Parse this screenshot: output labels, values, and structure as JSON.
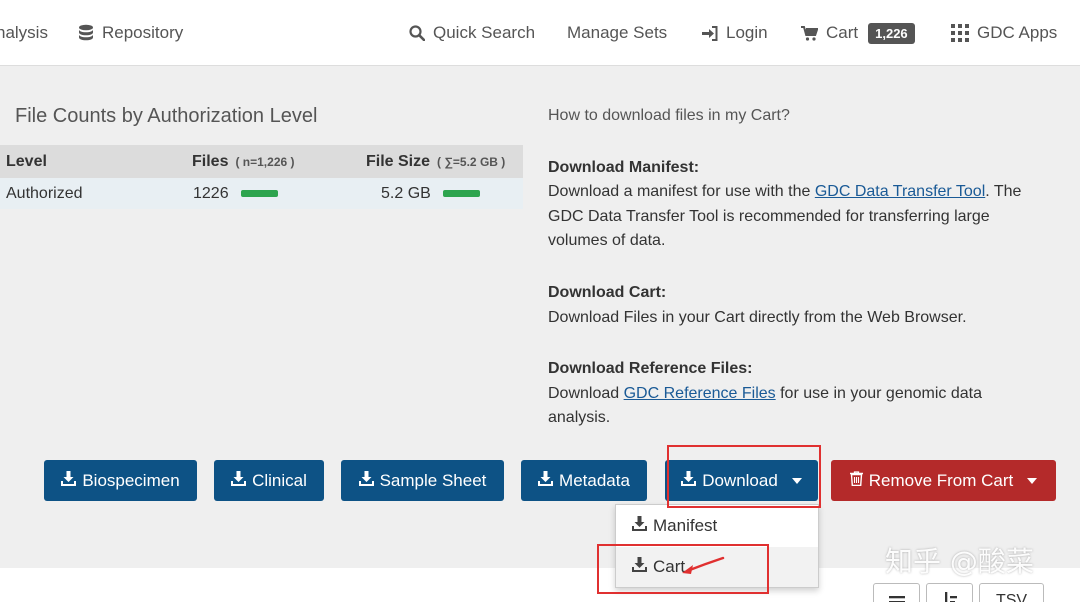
{
  "nav": {
    "analysis": "nalysis",
    "repository": "Repository",
    "quick_search": "Quick Search",
    "manage_sets": "Manage Sets",
    "login": "Login",
    "cart": "Cart",
    "cart_count": "1,226",
    "gdc_apps": "GDC Apps"
  },
  "counts": {
    "title": "File Counts by Authorization Level",
    "headers": {
      "level": "Level",
      "files": "Files",
      "files_sub": "( n=1,226 )",
      "file_size": "File Size",
      "file_size_sub": "( ∑=5.2 GB )"
    },
    "rows": [
      {
        "level": "Authorized",
        "files": "1226",
        "files_fraction": 1.0,
        "file_size": "5.2 GB",
        "size_fraction": 1.0
      }
    ]
  },
  "help": {
    "howto": "How to download files in my Cart?",
    "manifest_title": "Download Manifest:",
    "manifest_text1": "Download a manifest for use with the ",
    "manifest_link": "GDC Data Transfer Tool",
    "manifest_text2": ".",
    "manifest_text3": "The GDC Data Transfer Tool is recommended for transferring large volumes of data.",
    "cart_title": "Download Cart:",
    "cart_text": "Download Files in your Cart directly from the Web Browser.",
    "ref_title": "Download Reference Files:",
    "ref_text1": "Download ",
    "ref_link": "GDC Reference Files",
    "ref_text2": " for use in your genomic data analysis."
  },
  "buttons": {
    "biospecimen": "Biospecimen",
    "clinical": "Clinical",
    "sample_sheet": "Sample Sheet",
    "metadata": "Metadata",
    "download": "Download",
    "remove": "Remove From Cart"
  },
  "dropdown": {
    "manifest": "Manifest",
    "cart": "Cart"
  },
  "table_buttons": {
    "tsv": "TSV"
  },
  "watermark": "知乎 @酸菜",
  "colors": {
    "primary_blue": "#0d5285",
    "danger_red": "#b42a2a",
    "progress_green": "#2da44e",
    "highlight_red": "#e03030",
    "link_blue": "#1a5a96"
  }
}
